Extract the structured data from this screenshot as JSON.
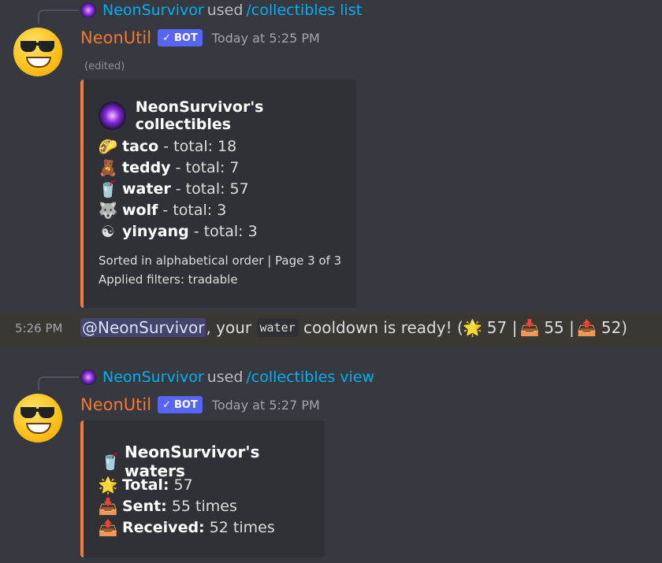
{
  "message1": {
    "reply": {
      "user": "NeonSurvivor",
      "used": "used",
      "command": "/collectibles list"
    },
    "author": "NeonUtil",
    "badge": "BOT",
    "timestamp": "Today at 5:25 PM",
    "edited": "(edited)",
    "embed": {
      "title": "NeonSurvivor's collectibles",
      "items": [
        {
          "icon": "taco-emoji",
          "glyph": "🌮",
          "name": "taco",
          "suffix": " - total: 18"
        },
        {
          "icon": "teddy-bear-emoji",
          "glyph": "🧸",
          "name": "teddy",
          "suffix": " - total: 7"
        },
        {
          "icon": "cup-with-straw-emoji",
          "glyph": "🥤",
          "name": "water",
          "suffix": " - total: 57"
        },
        {
          "icon": "wolf-emoji",
          "glyph": "🐺",
          "name": "wolf",
          "suffix": " - total: 3"
        },
        {
          "icon": "yin-yang-emoji",
          "glyph": "☯",
          "name": "yinyang",
          "suffix": " - total: 3"
        }
      ],
      "footer_line1": "Sorted in alphabetical order | Page 3 of 3",
      "footer_line2": "Applied filters: tradable"
    }
  },
  "message2": {
    "time": "5:26 PM",
    "mention": "@NeonSurvivor",
    "text1": ", your ",
    "code": "water",
    "text2": " cooldown is ready! (",
    "v1": "57 |",
    "v2": "55 |",
    "v3": "52)"
  },
  "message3": {
    "reply": {
      "user": "NeonSurvivor",
      "used": "used",
      "command": "/collectibles view"
    },
    "author": "NeonUtil",
    "badge": "BOT",
    "timestamp": "Today at 5:27 PM",
    "embed": {
      "title": "NeonSurvivor's waters",
      "rows": [
        {
          "icon": "star-emoji",
          "label": "Total:",
          "value": " 57"
        },
        {
          "icon": "inbox-tray-emoji",
          "label": "Sent:",
          "value": " 55 times"
        },
        {
          "icon": "outbox-tray-emoji",
          "label": "Received:",
          "value": " 52 times"
        }
      ]
    }
  },
  "colors": {
    "author": "#f57731",
    "link": "#00aff4",
    "badge": "#5865f2",
    "background": "#36393f",
    "embed": "#2f3136"
  }
}
